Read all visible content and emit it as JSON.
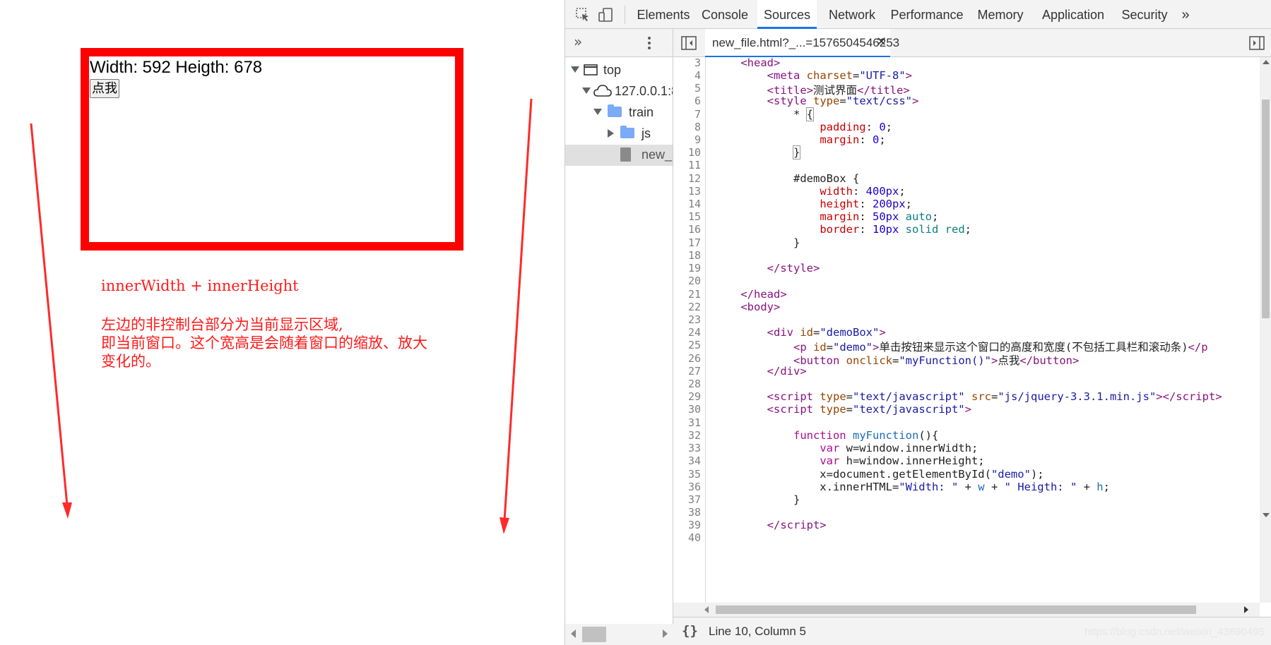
{
  "page": {
    "demo_text": "Width: 592 Heigth: 678",
    "button_label": "点我",
    "annotation_1": "innerWidth + innerHeight",
    "annotation_2": "左边的非控制台部分为当前显示区域,",
    "annotation_3": "即当前窗口。这个宽高是会随着窗口的缩放、放大",
    "annotation_4": "变化的。",
    "accent_color": "#ff0000"
  },
  "devtools": {
    "tabs": [
      "Elements",
      "Console",
      "Sources",
      "Network",
      "Performance",
      "Memory",
      "Application",
      "Security"
    ],
    "active_tab": "Sources",
    "overflow_icon": "»",
    "open_file": "new_file.html?_...=1576504546253",
    "navigator": {
      "items": [
        {
          "label": "top",
          "icon": "frame-icon"
        },
        {
          "label": "127.0.0.1:8",
          "icon": "cloud-icon"
        },
        {
          "label": "train",
          "icon": "folder-icon"
        },
        {
          "label": "js",
          "icon": "folder-icon"
        },
        {
          "label": "new_",
          "icon": "file-icon"
        }
      ]
    },
    "status": {
      "format_icon": "{}",
      "cursor": "Line 10, Column 5",
      "watermark": "https://blog.csdn.net/weixin_43690495"
    },
    "line_numbers": [
      "3",
      "4",
      "5",
      "6",
      "7",
      "8",
      "9",
      "10",
      "11",
      "12",
      "13",
      "14",
      "15",
      "16",
      "17",
      "18",
      "19",
      "20",
      "21",
      "22",
      "23",
      "24",
      "25",
      "26",
      "27",
      "28",
      "29",
      "30",
      "31",
      "32",
      "33",
      "34",
      "35",
      "36",
      "37",
      "38",
      "39",
      "40"
    ]
  }
}
